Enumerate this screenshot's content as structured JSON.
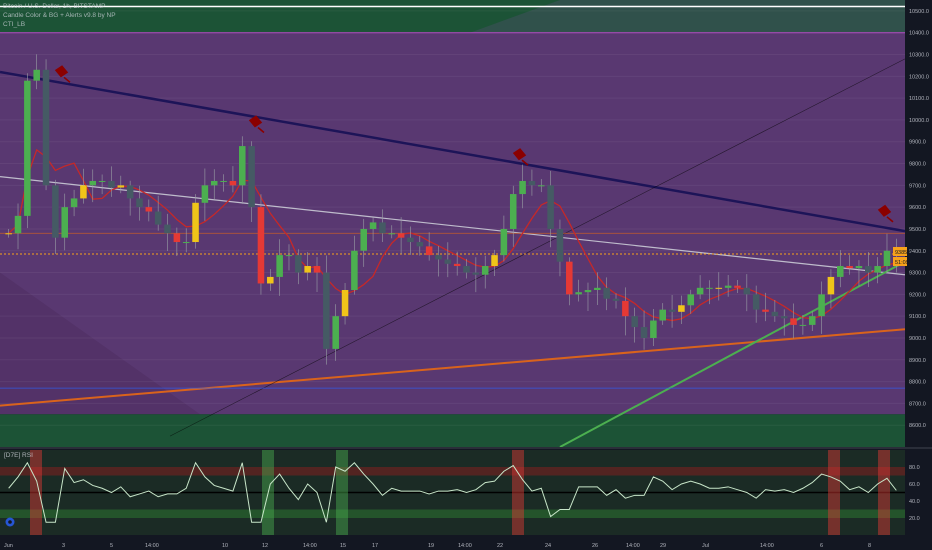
{
  "legend": {
    "symbol": "Bitcoin / U.S. Dollar, 1h, BITSTAMP",
    "indicator1": "Candle Color & BG + Alerts v9.8 by NP",
    "indicator2": "CTI_LB"
  },
  "rsi_panel": {
    "title": "[D7E] RSI"
  },
  "colors": {
    "background": "#131722",
    "purple_zone": "#5b3570",
    "green_zone": "#1f5e3a",
    "resistance_line": "#1d1458",
    "support_line": "#d9631c",
    "uptrend_line": "#4caf50",
    "white_trend": "#d1d4dc",
    "price_dotted": "#f7a21b",
    "magenta": "#e040fb",
    "alert_marker": "#8b0000"
  },
  "chart_data": {
    "type": "candlestick",
    "ylim": [
      8500,
      10550
    ],
    "y_ticks": [
      "10500.0",
      "10400.0",
      "10300.0",
      "10200.0",
      "10100.0",
      "10000.0",
      "9900.0",
      "9800.0",
      "9700.0",
      "9600.0",
      "9500.0",
      "9400.0",
      "9300.0",
      "9200.0",
      "9100.0",
      "9000.0",
      "8900.0",
      "8800.0",
      "8700.0",
      "8600.0"
    ],
    "y_tick_values": [
      10500,
      10400,
      10300,
      10200,
      10100,
      10000,
      9900,
      9800,
      9700,
      9600,
      9500,
      9400,
      9300,
      9200,
      9100,
      9000,
      8900,
      8800,
      8700,
      8600
    ],
    "current_price": "9385.0",
    "countdown": "51:09",
    "x_ticks": [
      "Jun",
      "3",
      "5",
      "14:00",
      "10",
      "12",
      "14:00",
      "15",
      "17",
      "19",
      "14:00",
      "22",
      "24",
      "26",
      "14:00",
      "29",
      "Jul",
      "14:00",
      "6",
      "8"
    ],
    "closes": [
      9480,
      9560,
      10180,
      10230,
      9700,
      9460,
      9600,
      9640,
      9700,
      9720,
      9720,
      9690,
      9700,
      9640,
      9600,
      9580,
      9520,
      9480,
      9440,
      9440,
      9620,
      9700,
      9720,
      9720,
      9700,
      9880,
      9600,
      9250,
      9280,
      9380,
      9380,
      9300,
      9330,
      9300,
      8950,
      9100,
      9220,
      9400,
      9500,
      9530,
      9480,
      9480,
      9460,
      9440,
      9420,
      9380,
      9360,
      9340,
      9330,
      9300,
      9290,
      9330,
      9380,
      9500,
      9660,
      9720,
      9700,
      9700,
      9500,
      9350,
      9200,
      9210,
      9220,
      9230,
      9180,
      9170,
      9100,
      9050,
      9000,
      9080,
      9130,
      9120,
      9150,
      9200,
      9230,
      9230,
      9230,
      9240,
      9230,
      9200,
      9130,
      9120,
      9100,
      9090,
      9060,
      9060,
      9100,
      9200,
      9280,
      9330,
      9320,
      9330,
      9300,
      9330,
      9400,
      9385
    ],
    "rsi": {
      "ylim": [
        0,
        100
      ],
      "y_ticks": [
        "80.0",
        "60.0",
        "40.0",
        "20.0"
      ],
      "y_tick_values": [
        80,
        60,
        40,
        20
      ],
      "overbought": 70,
      "oversold": 30,
      "midline": 50,
      "current_value": 60
    }
  }
}
